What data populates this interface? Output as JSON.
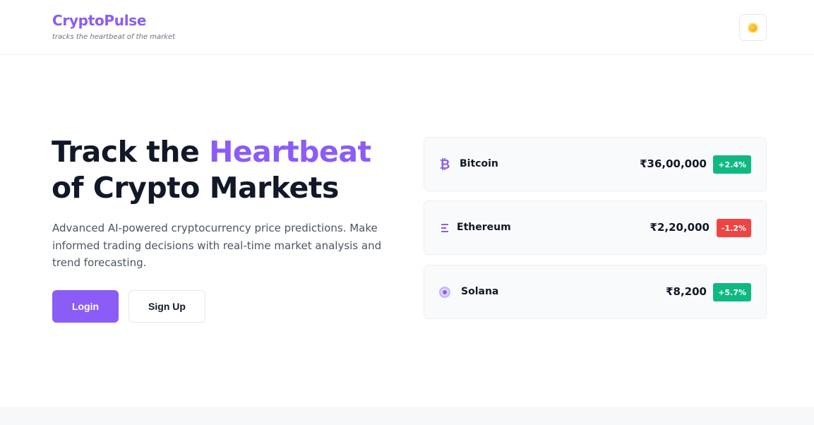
{
  "header": {
    "brand_name": "CryptoPulse",
    "tagline": "tracks the heartbeat of the market",
    "theme_toggle_icon": "sun-icon"
  },
  "hero": {
    "title_part1": "Track the ",
    "title_accent": "Heartbeat",
    "title_part2": "of Crypto Markets",
    "description": "Advanced AI-powered cryptocurrency price predictions. Make informed trading decisions with real-time market analysis and trend forecasting.",
    "login_label": "Login",
    "signup_label": "Sign Up"
  },
  "coins": [
    {
      "name": "Bitcoin",
      "icon": "bitcoin-icon",
      "price": "₹36,00,000",
      "change": "+2.4%",
      "trend": "up"
    },
    {
      "name": "Ethereum",
      "icon": "ethereum-icon",
      "price": "₹2,20,000",
      "change": "-1.2%",
      "trend": "down"
    },
    {
      "name": "Solana",
      "icon": "solana-icon",
      "price": "₹8,200",
      "change": "+5.7%",
      "trend": "up"
    }
  ],
  "colors": {
    "accent": "#8b5cf6",
    "positive": "#10b981",
    "negative": "#ef4444",
    "text": "#111827"
  }
}
